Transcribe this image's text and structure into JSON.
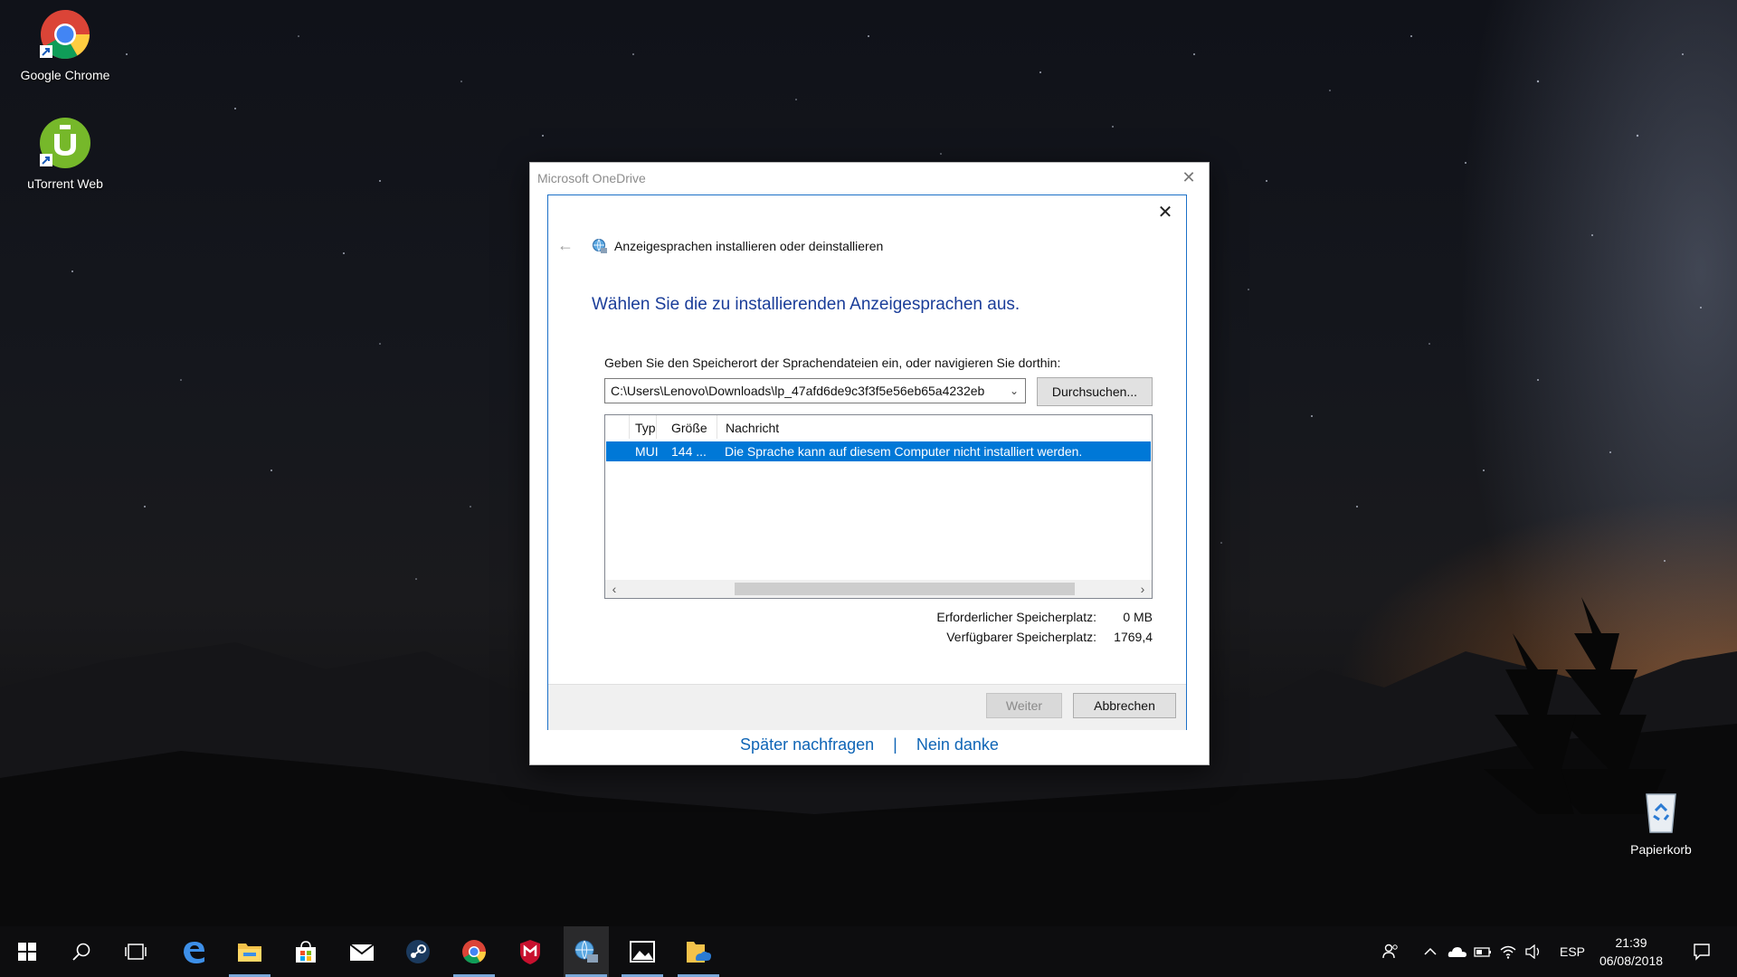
{
  "desktop": {
    "icons": [
      {
        "label": "Google Chrome"
      },
      {
        "label": "uTorrent Web"
      },
      {
        "label": "Papierkorb"
      }
    ]
  },
  "onedrive": {
    "title": "Microsoft OneDrive",
    "close_glyph": "✕",
    "link_later": "Später nachfragen",
    "link_separator": "|",
    "link_no": "Nein danke"
  },
  "dialog": {
    "close_glyph": "✕",
    "back_glyph": "←",
    "header": "Anzeigesprachen installieren oder deinstallieren",
    "heading": "Wählen Sie die zu installierenden Anzeigesprachen aus.",
    "path_label": "Geben Sie den Speicherort der Sprachendateien ein, oder navigieren Sie dorthin:",
    "path_value": "C:\\Users\\Lenovo\\Downloads\\lp_47afd6de9c3f3f5e56eb65a4232eb",
    "browse_label": "Durchsuchen...",
    "columns": {
      "type": "Typ",
      "size": "Größe",
      "message": "Nachricht"
    },
    "rows": [
      {
        "type": "MUI",
        "size": "144 ...",
        "message": "Die Sprache kann auf diesem Computer nicht installiert werden."
      }
    ],
    "required_label": "Erforderlicher Speicherplatz:",
    "required_value": "0 MB",
    "available_label": "Verfügbarer Speicherplatz:",
    "available_value": "1769,4",
    "next_label": "Weiter",
    "cancel_label": "Abbrechen"
  },
  "taskbar": {
    "items": [
      "start-icon",
      "search-icon",
      "task-view-icon",
      "edge-icon",
      "file-explorer-icon",
      "store-icon",
      "mail-icon",
      "steam-icon",
      "chrome-icon",
      "mcafee-icon",
      "language-settings-icon",
      "photos-icon",
      "folder-onedrive-icon"
    ],
    "input_language": "ESP",
    "time": "21:39",
    "date": "06/08/2018"
  },
  "colors": {
    "accent": "#0078d7",
    "dialog_border": "#1c70c8",
    "heading_blue": "#1a3d99",
    "link_blue": "#0f65b6"
  }
}
